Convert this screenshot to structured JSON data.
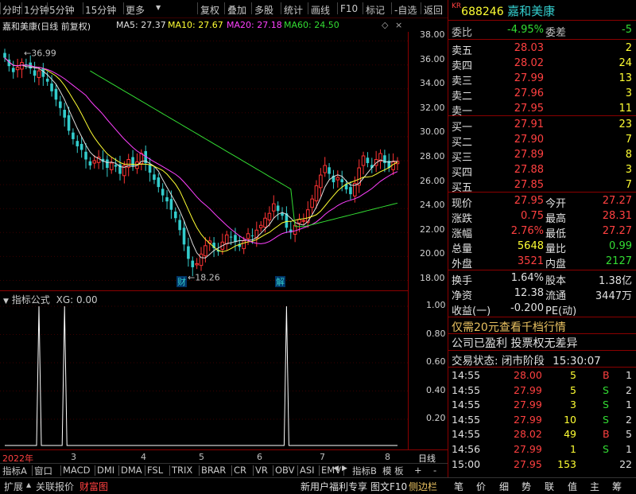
{
  "toolbar": {
    "left": [
      "分时",
      "1分钟",
      "5分钟",
      "15分钟",
      "更多"
    ],
    "right": [
      "复权",
      "叠加",
      "多股",
      "统计",
      "画线",
      "F10",
      "标记",
      "-自选",
      "返回"
    ]
  },
  "chart_header": {
    "name": "嘉和美康(日线 前复权)",
    "ma5": "MA5: 27.37",
    "ma10": "MA10: 27.67",
    "ma20": "MA20: 27.18",
    "ma60": "MA60: 24.50"
  },
  "main_axis": [
    "38.00",
    "36.00",
    "34.00",
    "32.00",
    "30.00",
    "28.00",
    "26.00",
    "24.00",
    "22.00",
    "20.00",
    "18.00"
  ],
  "annotations": {
    "high": "36.99",
    "low": "18.26",
    "mark_cai": "财",
    "mark_jie": "解"
  },
  "sub_header": {
    "label": "指标公式",
    "value": "XG: 0.00"
  },
  "sub_axis": [
    "1.00",
    "0.80",
    "0.60",
    "0.40",
    "0.20"
  ],
  "date_axis": {
    "year": "2022年",
    "months": [
      "3",
      "4",
      "5",
      "6",
      "7",
      "8"
    ],
    "period": "日线"
  },
  "indicator_tabs": [
    "指标A",
    "窗口",
    "MACD",
    "DMI",
    "DMA",
    "FSL",
    "TRIX",
    "BRAR",
    "CR",
    "VR",
    "OBV",
    "ASI",
    "EMV"
  ],
  "indicator_tabs_right": [
    "指标B",
    "模 板",
    "+",
    "-"
  ],
  "status_bar": {
    "left": [
      "扩展",
      "关联报价",
      "财富图"
    ],
    "right": [
      "新用户福利专享",
      "图文F10",
      "侧边栏"
    ],
    "icons": [
      "笔",
      "价",
      "细",
      "势",
      "联",
      "值",
      "主",
      "筹"
    ]
  },
  "quote": {
    "code": "688246",
    "name": "嘉和美康",
    "webi_label": "委比",
    "webi": "-4.95%",
    "weicha_label": "委差",
    "weicha": "-5",
    "asks": [
      {
        "label": "卖五",
        "price": "28.03",
        "vol": "2"
      },
      {
        "label": "卖四",
        "price": "28.02",
        "vol": "24"
      },
      {
        "label": "卖三",
        "price": "27.99",
        "vol": "13"
      },
      {
        "label": "卖二",
        "price": "27.96",
        "vol": "3"
      },
      {
        "label": "卖一",
        "price": "27.95",
        "vol": "11"
      }
    ],
    "bids": [
      {
        "label": "买一",
        "price": "27.91",
        "vol": "23"
      },
      {
        "label": "买二",
        "price": "27.90",
        "vol": "7"
      },
      {
        "label": "买三",
        "price": "27.89",
        "vol": "8"
      },
      {
        "label": "买四",
        "price": "27.88",
        "vol": "3"
      },
      {
        "label": "买五",
        "price": "27.85",
        "vol": "7"
      }
    ],
    "stats": [
      {
        "l1": "现价",
        "v1": "27.95",
        "l2": "今开",
        "v2": "27.27"
      },
      {
        "l1": "涨跌",
        "v1": "0.75",
        "l2": "最高",
        "v2": "28.31"
      },
      {
        "l1": "涨幅",
        "v1": "2.76%",
        "l2": "最低",
        "v2": "27.27"
      },
      {
        "l1": "总量",
        "v1": "5648",
        "l2": "量比",
        "v2": "0.99"
      },
      {
        "l1": "外盘",
        "v1": "3521",
        "l2": "内盘",
        "v2": "2127"
      }
    ],
    "stats2": [
      {
        "l1": "换手",
        "v1": "1.64%",
        "l2": "股本",
        "v2": "1.38亿"
      },
      {
        "l1": "净资",
        "v1": "12.38",
        "l2": "流通",
        "v2": "3447万"
      },
      {
        "l1": "收益(一)",
        "v1": "-0.200",
        "l2": "PE(动)",
        "v2": ""
      }
    ],
    "promo": "仅需20元查看千档行情",
    "notice": "公司已盈利 投票权无差异",
    "trade_status_label": "交易状态: 闭市阶段",
    "trade_status_time": "15:30:07",
    "ticks": [
      {
        "t": "14:55",
        "p": "28.00",
        "v": "5",
        "d": "B",
        "n": "1"
      },
      {
        "t": "14:55",
        "p": "27.99",
        "v": "5",
        "d": "S",
        "n": "2"
      },
      {
        "t": "14:55",
        "p": "27.99",
        "v": "3",
        "d": "S",
        "n": "1"
      },
      {
        "t": "14:55",
        "p": "27.99",
        "v": "10",
        "d": "S",
        "n": "2"
      },
      {
        "t": "14:55",
        "p": "28.02",
        "v": "49",
        "d": "B",
        "n": "5"
      },
      {
        "t": "14:56",
        "p": "27.99",
        "v": "1",
        "d": "S",
        "n": "1"
      },
      {
        "t": "15:00",
        "p": "27.95",
        "v": "153",
        "d": "",
        "n": "22"
      }
    ]
  },
  "chart_data": {
    "type": "candlestick",
    "ylim": [
      17.5,
      38.5
    ],
    "closes": [
      36.6,
      35.9,
      35.4,
      35.8,
      36.2,
      36.0,
      35.7,
      35.1,
      35.5,
      35.0,
      34.6,
      33.8,
      33.1,
      32.4,
      31.6,
      30.5,
      29.8,
      29.2,
      28.9,
      28.1,
      27.6,
      28.0,
      28.3,
      27.9,
      27.4,
      27.8,
      27.5,
      26.9,
      27.6,
      28.1,
      27.5,
      27.9,
      28.6,
      27.8,
      27.0,
      26.4,
      25.8,
      25.1,
      24.6,
      23.9,
      23.2,
      22.2,
      21.0,
      19.8,
      19.1,
      19.4,
      20.2,
      20.9,
      21.3,
      20.7,
      20.4,
      21.2,
      21.8,
      21.6,
      21.2,
      20.8,
      21.3,
      21.9,
      21.7,
      22.2,
      22.6,
      23.2,
      23.6,
      24.4,
      23.8,
      23.4,
      22.4,
      22.0,
      22.6,
      23.1,
      23.0,
      23.9,
      24.8,
      25.9,
      26.8,
      27.6,
      26.9,
      26.2,
      26.6,
      26.2,
      25.6,
      25.2,
      26.1,
      27.4,
      28.4,
      27.8,
      27.4,
      28.1,
      28.6,
      27.8,
      27.4,
      27.9,
      27.95
    ],
    "xg_signal_indices": [
      8,
      14,
      66
    ]
  }
}
